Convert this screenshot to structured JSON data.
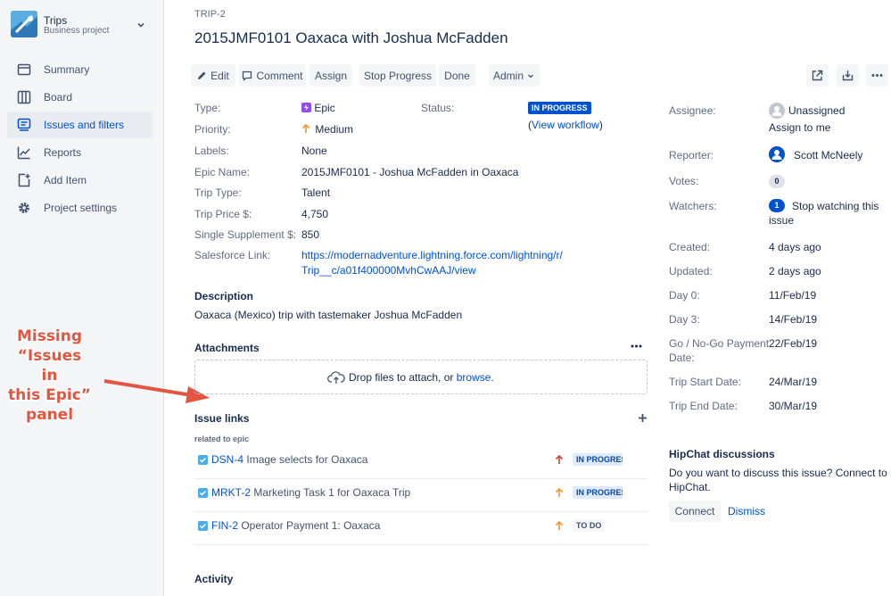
{
  "sidebar": {
    "project_name": "Trips",
    "project_type": "Business project",
    "items": [
      {
        "label": "Summary"
      },
      {
        "label": "Board"
      },
      {
        "label": "Issues and filters"
      },
      {
        "label": "Reports"
      },
      {
        "label": "Add Item"
      },
      {
        "label": "Project settings"
      }
    ]
  },
  "annotation": {
    "lines": [
      "Missing",
      "“Issues in",
      "this Epic”",
      "panel"
    ]
  },
  "issue": {
    "key": "TRIP-2",
    "title": "2015JMF0101 Oaxaca with Joshua McFadden"
  },
  "toolbar": {
    "edit": "Edit",
    "comment": "Comment",
    "assign": "Assign",
    "stop_progress": "Stop Progress",
    "done": "Done",
    "admin": "Admin"
  },
  "details": {
    "type_label": "Type:",
    "type_value": "Epic",
    "priority_label": "Priority:",
    "priority_value": "Medium",
    "labels_label": "Labels:",
    "labels_value": "None",
    "epic_name_label": "Epic Name:",
    "epic_name_value": "2015JMF0101 - Joshua McFadden in Oaxaca",
    "trip_type_label": "Trip Type:",
    "trip_type_value": "Talent",
    "trip_price_label": "Trip Price $:",
    "trip_price_value": "4,750",
    "single_supp_label": "Single Supplement $:",
    "single_supp_value": "850",
    "sf_link_label": "Salesforce Link:",
    "sf_link_line1": "https://modernadventure.lightning.force.com/lightning/r/",
    "sf_link_line2": "Trip__c/a01f400000MvhCwAAJ/view",
    "status_label": "Status:",
    "status_value": "IN PROGRESS",
    "view_workflow": "View workflow",
    "paren_open": "(",
    "paren_close": ")"
  },
  "description": {
    "title": "Description",
    "text": "Oaxaca (Mexico) trip with tastemaker Joshua McFadden"
  },
  "attachments": {
    "title": "Attachments",
    "drop_text": "Drop files to attach, or",
    "browse": "browse."
  },
  "issue_links": {
    "title": "Issue links",
    "relation": "related to epic",
    "rows": [
      {
        "key": "DSN-4",
        "summary": "Image selects for Oaxaca",
        "status": "IN PROGRESS",
        "priority_color": "#d04437"
      },
      {
        "key": "MRKT-2",
        "summary": "Marketing Task 1 for Oaxaca Trip",
        "status": "IN PROGRESS",
        "priority_color": "#f79232"
      },
      {
        "key": "FIN-2",
        "summary": "Operator Payment 1: Oaxaca",
        "status": "TO DO",
        "priority_color": "#f79232"
      }
    ]
  },
  "activity": {
    "title": "Activity"
  },
  "people": {
    "assignee_label": "Assignee:",
    "assignee_value": "Unassigned",
    "assign_to_me": "Assign to me",
    "reporter_label": "Reporter:",
    "reporter_value": "Scott McNeely",
    "votes_label": "Votes:",
    "votes_value": "0",
    "watchers_label": "Watchers:",
    "watchers_value": "1",
    "stop_watching_1": "Stop watching this",
    "stop_watching_2": "issue"
  },
  "dates": {
    "created_label": "Created:",
    "created_value": "4 days ago",
    "updated_label": "Updated:",
    "updated_value": "2 days ago",
    "day0_label": "Day 0:",
    "day0_value": "11/Feb/19",
    "day3_label": "Day 3:",
    "day3_value": "14/Feb/19",
    "gonogo_label_1": "Go / No-Go Payment",
    "gonogo_label_2": "Date:",
    "gonogo_value": "22/Feb/19",
    "start_label": "Trip Start Date:",
    "start_value": "24/Mar/19",
    "end_label": "Trip End Date:",
    "end_value": "30/Mar/19"
  },
  "hipchat": {
    "title": "HipChat discussions",
    "text_1": "Do you want to discuss this issue? Connect to",
    "text_2": "HipChat.",
    "connect": "Connect",
    "dismiss": "Dismiss"
  },
  "colors": {
    "brand": "#0052cc",
    "annotation": "#e25541",
    "status_blue": "#0052cc"
  }
}
